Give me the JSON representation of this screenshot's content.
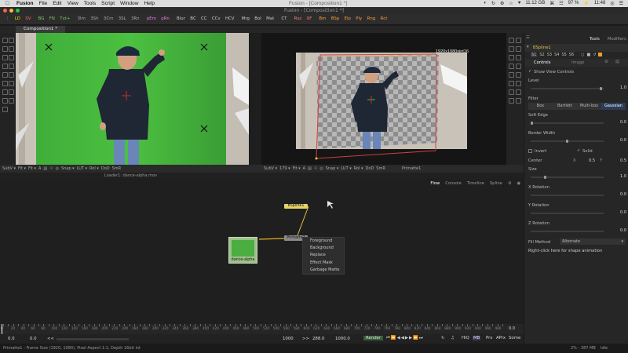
{
  "menubar": {
    "app": "Fusion",
    "items": [
      "File",
      "Edit",
      "View",
      "Tools",
      "Script",
      "Window",
      "Help"
    ],
    "window_title": "Fusion - [Composition1 *]",
    "right": [
      "◐",
      "↻",
      "⚙",
      "☆",
      "♥",
      "11:12 GB",
      "⌘",
      "☷",
      "97 %",
      "⚡",
      "11:48",
      "◎",
      "☰"
    ]
  },
  "toolbar": {
    "items": [
      {
        "label": "LD",
        "color": "#ffd400"
      },
      {
        "label": "SV",
        "color": "#ff6a6a"
      },
      {
        "label": "BG",
        "color": "#7fc95a"
      },
      {
        "label": "FN",
        "color": "#7fc95a"
      },
      {
        "label": "Txt+",
        "color": "#7fc95a"
      },
      {
        "label": "3Im",
        "color": "#aaaaaa"
      },
      {
        "label": "3Sh",
        "color": "#aaaaaa"
      },
      {
        "label": "3Cm",
        "color": "#aaaaaa"
      },
      {
        "label": "3SL",
        "color": "#aaaaaa"
      },
      {
        "label": "3Rn",
        "color": "#aaaaaa"
      },
      {
        "label": "pEm",
        "color": "#e080e0"
      },
      {
        "label": "pRn",
        "color": "#e080e0"
      },
      {
        "label": "Blur",
        "color": "#cccccc"
      },
      {
        "label": "BC",
        "color": "#cccccc"
      },
      {
        "label": "CC",
        "color": "#cccccc"
      },
      {
        "label": "CCv",
        "color": "#cccccc"
      },
      {
        "label": "HCV",
        "color": "#cccccc"
      },
      {
        "label": "Mrg",
        "color": "#cccccc"
      },
      {
        "label": "Bol",
        "color": "#cccccc"
      },
      {
        "label": "Mat",
        "color": "#cccccc"
      },
      {
        "label": "CT",
        "color": "#cccccc"
      },
      {
        "label": "Rsz",
        "color": "#ff8080"
      },
      {
        "label": "XF",
        "color": "#ff8080"
      },
      {
        "label": "Bm",
        "color": "#ffa040"
      },
      {
        "label": "BSp",
        "color": "#ffa040"
      },
      {
        "label": "Elp",
        "color": "#ffa040"
      },
      {
        "label": "Ply",
        "color": "#ffa040"
      },
      {
        "label": "Rng",
        "color": "#ffa040"
      },
      {
        "label": "Rct",
        "color": "#ffa040"
      }
    ]
  },
  "tabs": {
    "composition": "Composition1 *"
  },
  "viewers": {
    "left": {
      "caption": "Loader1: dance-alpha.mov"
    },
    "right": {
      "label": "1920x1080xint16"
    },
    "bar_left": [
      "SubV ▾",
      "Fit ▾",
      "Fit ▾",
      "A",
      "▤",
      "☉",
      "◎",
      "Snap ▾",
      "LUT ▾",
      "Rol ▾",
      "DoD",
      "SmR"
    ],
    "bar_right": [
      "SubV ▾",
      "179 ▾",
      "Fit ▾",
      "A",
      "▤",
      "☉",
      "◎",
      "Snap ▾",
      "LUT ▾",
      "Rol ▾",
      "DoD",
      "SmR",
      "Primatte1"
    ]
  },
  "flow": {
    "tabs": [
      "Flow",
      "Console",
      "Timeline",
      "Spline"
    ],
    "nodes": {
      "bspline": "BSpline1",
      "primatte": "Primatte1",
      "loader": "dance-alpha"
    },
    "context_menu": [
      "Foreground",
      "Background",
      "Replace",
      "Effect Mask",
      "Garbage Matte"
    ]
  },
  "ruler": {
    "ticks": [
      "0",
      "10",
      "20",
      "30",
      "40",
      "50",
      "60",
      "70",
      "80",
      "90",
      "100",
      "110",
      "120",
      "130",
      "140",
      "150",
      "160",
      "170",
      "180",
      "190",
      "200",
      "210",
      "220",
      "230",
      "240",
      "250",
      "260",
      "270",
      "280",
      "290",
      "300",
      "310",
      "320",
      "330",
      "340",
      "350",
      "360",
      "370",
      "380",
      "390",
      "400",
      "410",
      "420",
      "430",
      "440",
      "450",
      "460",
      "470",
      "480",
      "490",
      "500",
      "510",
      "520",
      "530",
      "540",
      "550",
      "560",
      "570",
      "580",
      "590",
      "600",
      "610",
      "620",
      "630",
      "640",
      "650",
      "660",
      "670",
      "680",
      "690",
      "700",
      "710",
      "720",
      "730",
      "740",
      "750",
      "760",
      "770",
      "780",
      "790",
      "800",
      "810",
      "820",
      "830",
      "840",
      "850",
      "860",
      "870",
      "880",
      "890",
      "900",
      "910",
      "920",
      "930",
      "940",
      "950",
      "960",
      "970",
      "980",
      "990"
    ],
    "current": "0.0"
  },
  "transport": {
    "start": "0.0",
    "render_start": "0.0",
    "nav": "<<",
    "end": "1000",
    "nav2": ">>",
    "current": "288.0",
    "render_end": "1000.0",
    "render_label": "Render",
    "buttons": [
      "HiQ",
      "MB",
      "Prx",
      "APrx",
      "Some"
    ]
  },
  "status": {
    "left": "Primatte1 - Frame Size (1920, 1080), Pixel Aspect 1:1, Depth 16bit int",
    "mem": "2% - 387 MB",
    "state": "Idle"
  },
  "inspector": {
    "tabs": [
      "Tools",
      "Modifiers"
    ],
    "tool_name": "BSpline1",
    "subtabs": [
      "Controls",
      "Image"
    ],
    "show_view_controls": "Show View Controls",
    "level_label": "Level",
    "level_value": "1.0",
    "filter_label": "Filter",
    "filter_options": [
      "Box",
      "Bartlett",
      "Multi-box",
      "Gaussian"
    ],
    "soft_edge_label": "Soft Edge",
    "soft_edge_value": "0.0",
    "border_width_label": "Border Width",
    "border_width_value": "0.0",
    "invert_label": "Invert",
    "solid_label": "Solid",
    "center_label": "Center",
    "center_x": "0.5",
    "center_y": "0.5",
    "size_label": "Size",
    "size_value": "1.0",
    "xrot_label": "X Rotation",
    "xrot_value": "0.0",
    "yrot_label": "Y Rotation",
    "yrot_value": "0.0",
    "zrot_label": "Z Rotation",
    "zrot_value": "0.0",
    "fill_method_label": "Fill Method",
    "fill_method_value": "Alternate",
    "hint": "Right-click here for shape animation"
  }
}
